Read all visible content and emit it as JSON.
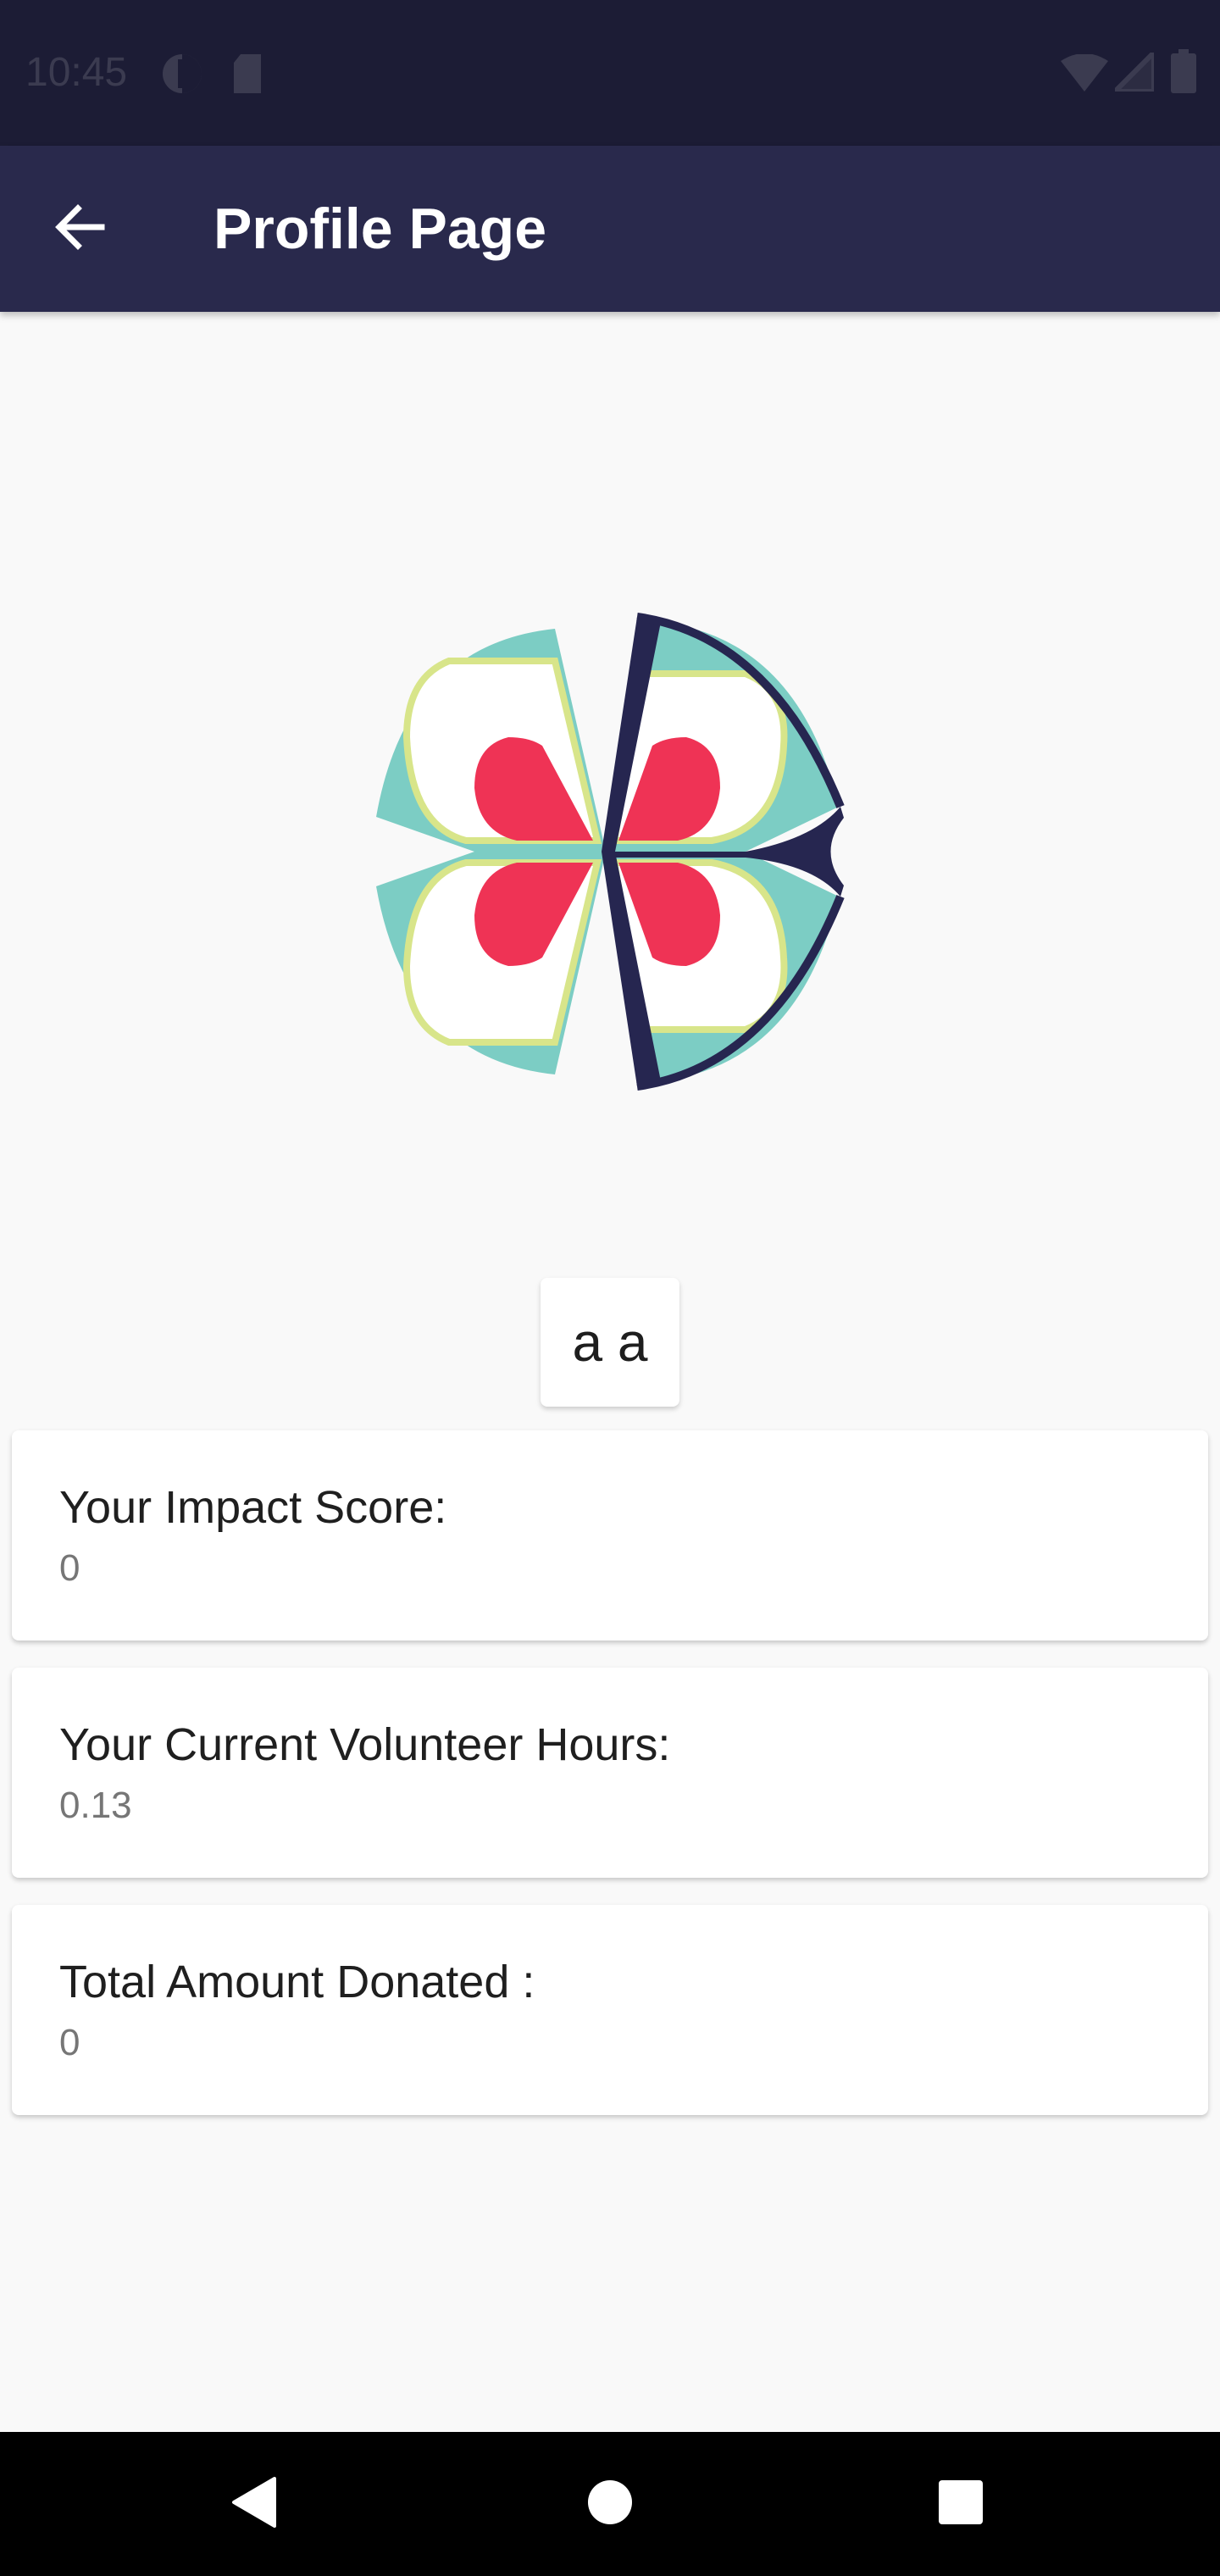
{
  "status_bar": {
    "time": "10:45",
    "icons": [
      "data-saver-icon",
      "sd-card-icon",
      "wifi-icon",
      "signal-icon",
      "battery-icon"
    ]
  },
  "app_bar": {
    "title": "Profile Page",
    "back_icon": "arrow-back-icon",
    "background": "#29294c"
  },
  "profile": {
    "logo_icon": "app-logo-flower",
    "name": "a a"
  },
  "stats": [
    {
      "label": "Your Impact Score:",
      "value": "0"
    },
    {
      "label": "Your Current Volunteer Hours:",
      "value": "0.13"
    },
    {
      "label": "Total Amount Donated :",
      "value": "0"
    }
  ],
  "nav_bar": {
    "icons": [
      "back-triangle-icon",
      "home-circle-icon",
      "recents-square-icon"
    ]
  },
  "colors": {
    "teal": "#7ccdc4",
    "red": "#ef3355",
    "navy": "#262650",
    "lime": "#d8e58a"
  }
}
